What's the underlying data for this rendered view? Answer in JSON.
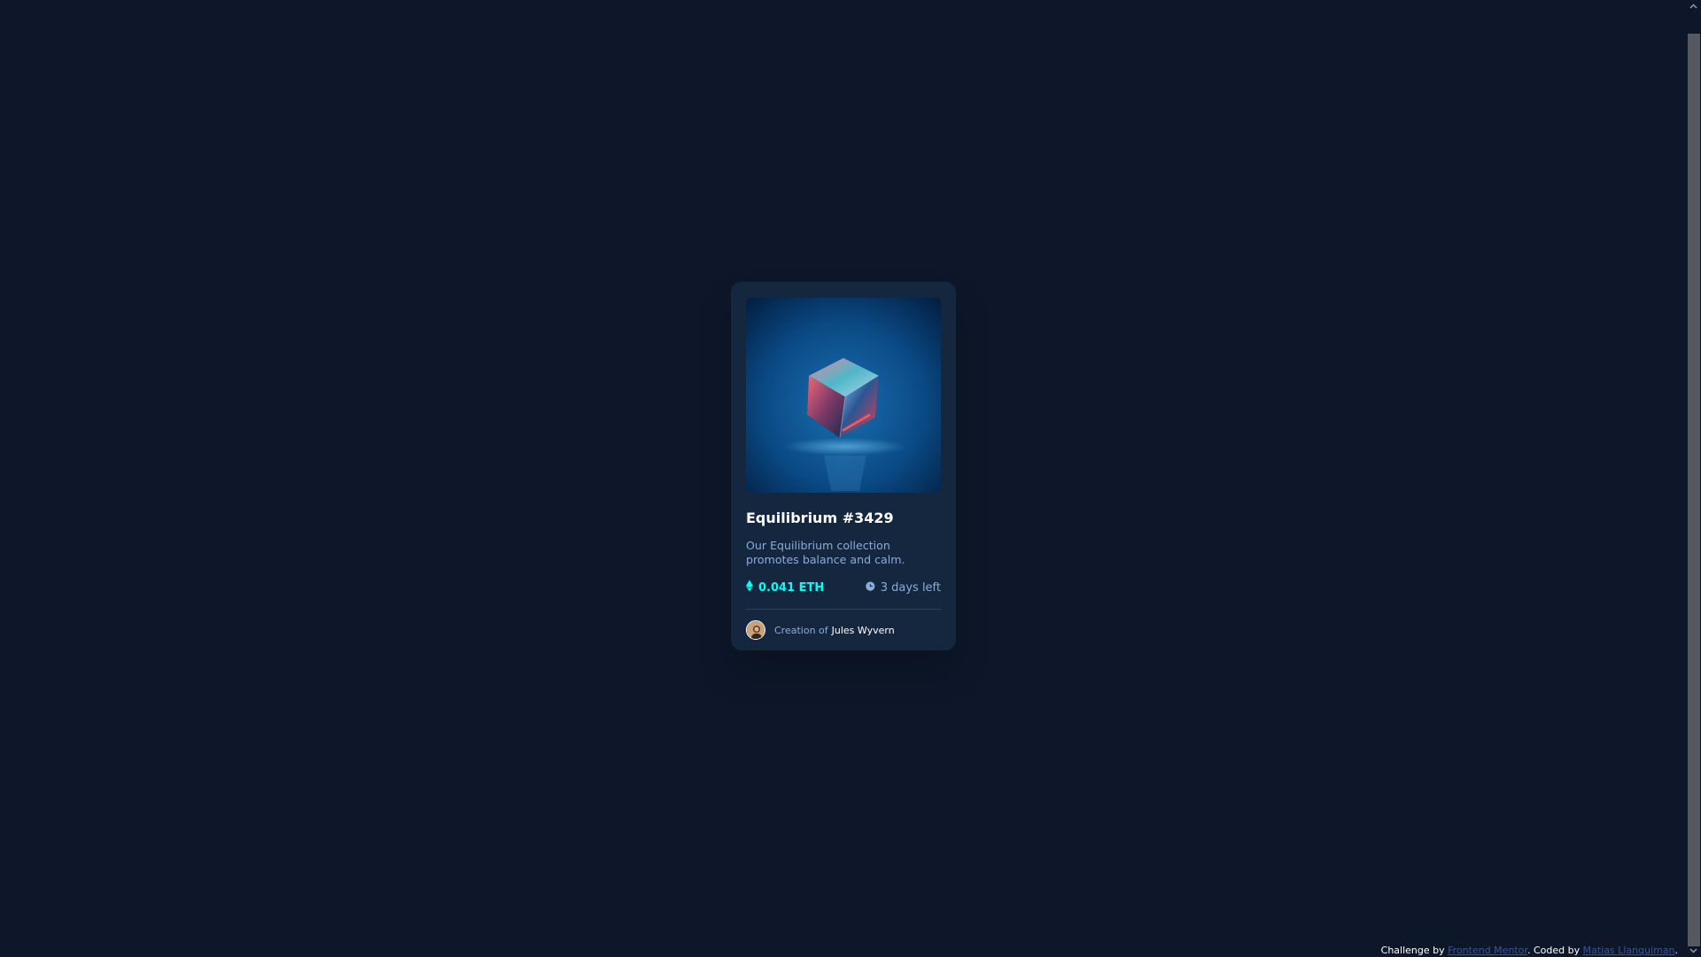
{
  "card": {
    "title": "Equilibrium #3429",
    "description": "Our Equilibrium collection promotes balance and calm.",
    "price": "0.041 ETH",
    "time_left": "3 days left",
    "creator_prefix": "Creation of",
    "creator_name": "Jules Wyvern",
    "image_icon": "crystal-cube-image",
    "price_icon": "ethereum-icon",
    "time_icon": "clock-icon"
  },
  "footer": {
    "prefix": "Challenge by",
    "challenge_link": "Frontend Mentor",
    "middle": ". Coded by",
    "author_link": "Matias Llanquiman",
    "suffix": "."
  },
  "colors": {
    "page_bg": "#0d1729",
    "card_bg": "#15263f",
    "accent_cyan": "#00fff8",
    "soft_blue": "#8bacd9",
    "link_blue": "#3e52a3"
  }
}
